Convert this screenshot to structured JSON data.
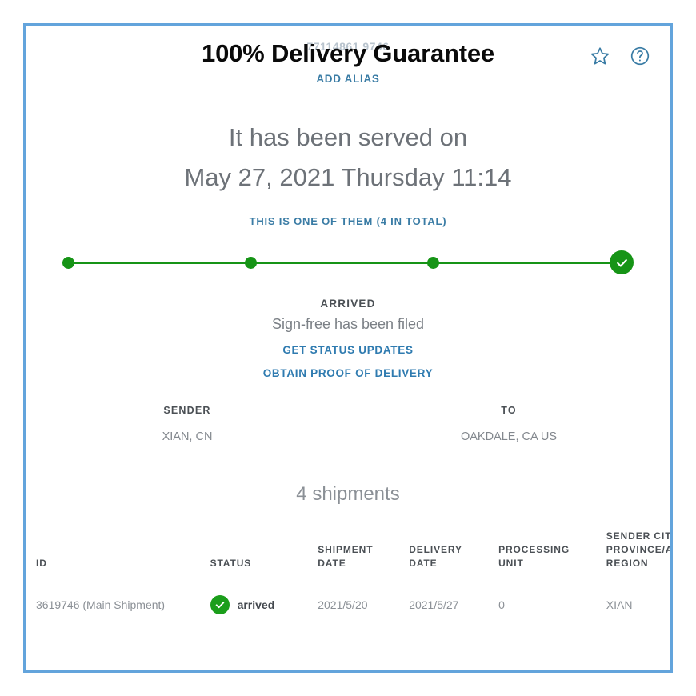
{
  "frame": {
    "border_color": "#63a4dc"
  },
  "header": {
    "tracking_number_ghost": "77114861 9746",
    "title": "100% Delivery Guarantee",
    "add_alias_label": "ADD ALIAS",
    "star_icon": "star-icon",
    "help_icon": "help-circle-icon"
  },
  "summary": {
    "served_line_1": "It has been served on",
    "served_line_2": "May 27, 2021 Thursday 11:14",
    "one_of_them_label": "THIS IS ONE OF THEM (4 IN TOTAL)"
  },
  "progress": {
    "color": "#169416",
    "steps_total": 4,
    "steps_completed": 4,
    "final_icon": "check-icon"
  },
  "status": {
    "title": "ARRIVED",
    "subtitle": "Sign-free has been filed",
    "link_status_updates": "GET STATUS UPDATES",
    "link_proof_of_delivery": "OBTAIN PROOF OF DELIVERY"
  },
  "addresses": {
    "sender_label": "SENDER",
    "sender_value": "XIAN, CN",
    "to_label": "TO",
    "to_value": "OAKDALE, CA US"
  },
  "shipments": {
    "count_label": "4 shipments",
    "columns": [
      "ID",
      "STATUS",
      "SHIPMENT DATE",
      "DELIVERY DATE",
      "PROCESSING UNIT",
      "SENDER CITY, PROVINCE/AUTONOMOUS REGION"
    ],
    "rows": [
      {
        "id": "3619746 (Main Shipment)",
        "status": "arrived",
        "status_icon": "check-icon",
        "shipment_date": "2021/5/20",
        "delivery_date": "2021/5/27",
        "processing_unit": "0",
        "sender_city": "XIAN"
      }
    ]
  }
}
